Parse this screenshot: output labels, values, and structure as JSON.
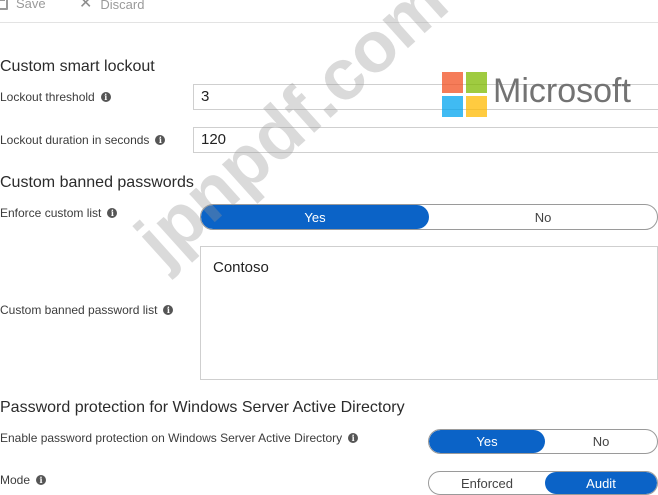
{
  "toolbar": {
    "save_label": "Save",
    "discard_label": "Discard"
  },
  "smart_lockout": {
    "heading": "Custom smart lockout",
    "threshold_label": "Lockout threshold",
    "threshold_value": "3",
    "duration_label": "Lockout duration in seconds",
    "duration_value": "120"
  },
  "banned_passwords": {
    "heading": "Custom banned passwords",
    "enforce_label": "Enforce custom list",
    "enforce_options": [
      "Yes",
      "No"
    ],
    "enforce_selected": "Yes",
    "list_label": "Custom banned password list",
    "list_value": "Contoso"
  },
  "ad_protection": {
    "heading": "Password protection for Windows Server Active Directory",
    "enable_label": "Enable password protection on Windows Server Active Directory",
    "enable_options": [
      "Yes",
      "No"
    ],
    "enable_selected": "Yes",
    "mode_label": "Mode",
    "mode_options": [
      "Enforced",
      "Audit"
    ],
    "mode_selected": "Audit"
  },
  "branding": {
    "logo_text": "Microsoft",
    "logo_colors": [
      "#f25022",
      "#7fba00",
      "#00a4ef",
      "#ffb900"
    ],
    "watermark": "jpnpdf.com"
  },
  "colors": {
    "toggle_active": "#0b63c7"
  }
}
